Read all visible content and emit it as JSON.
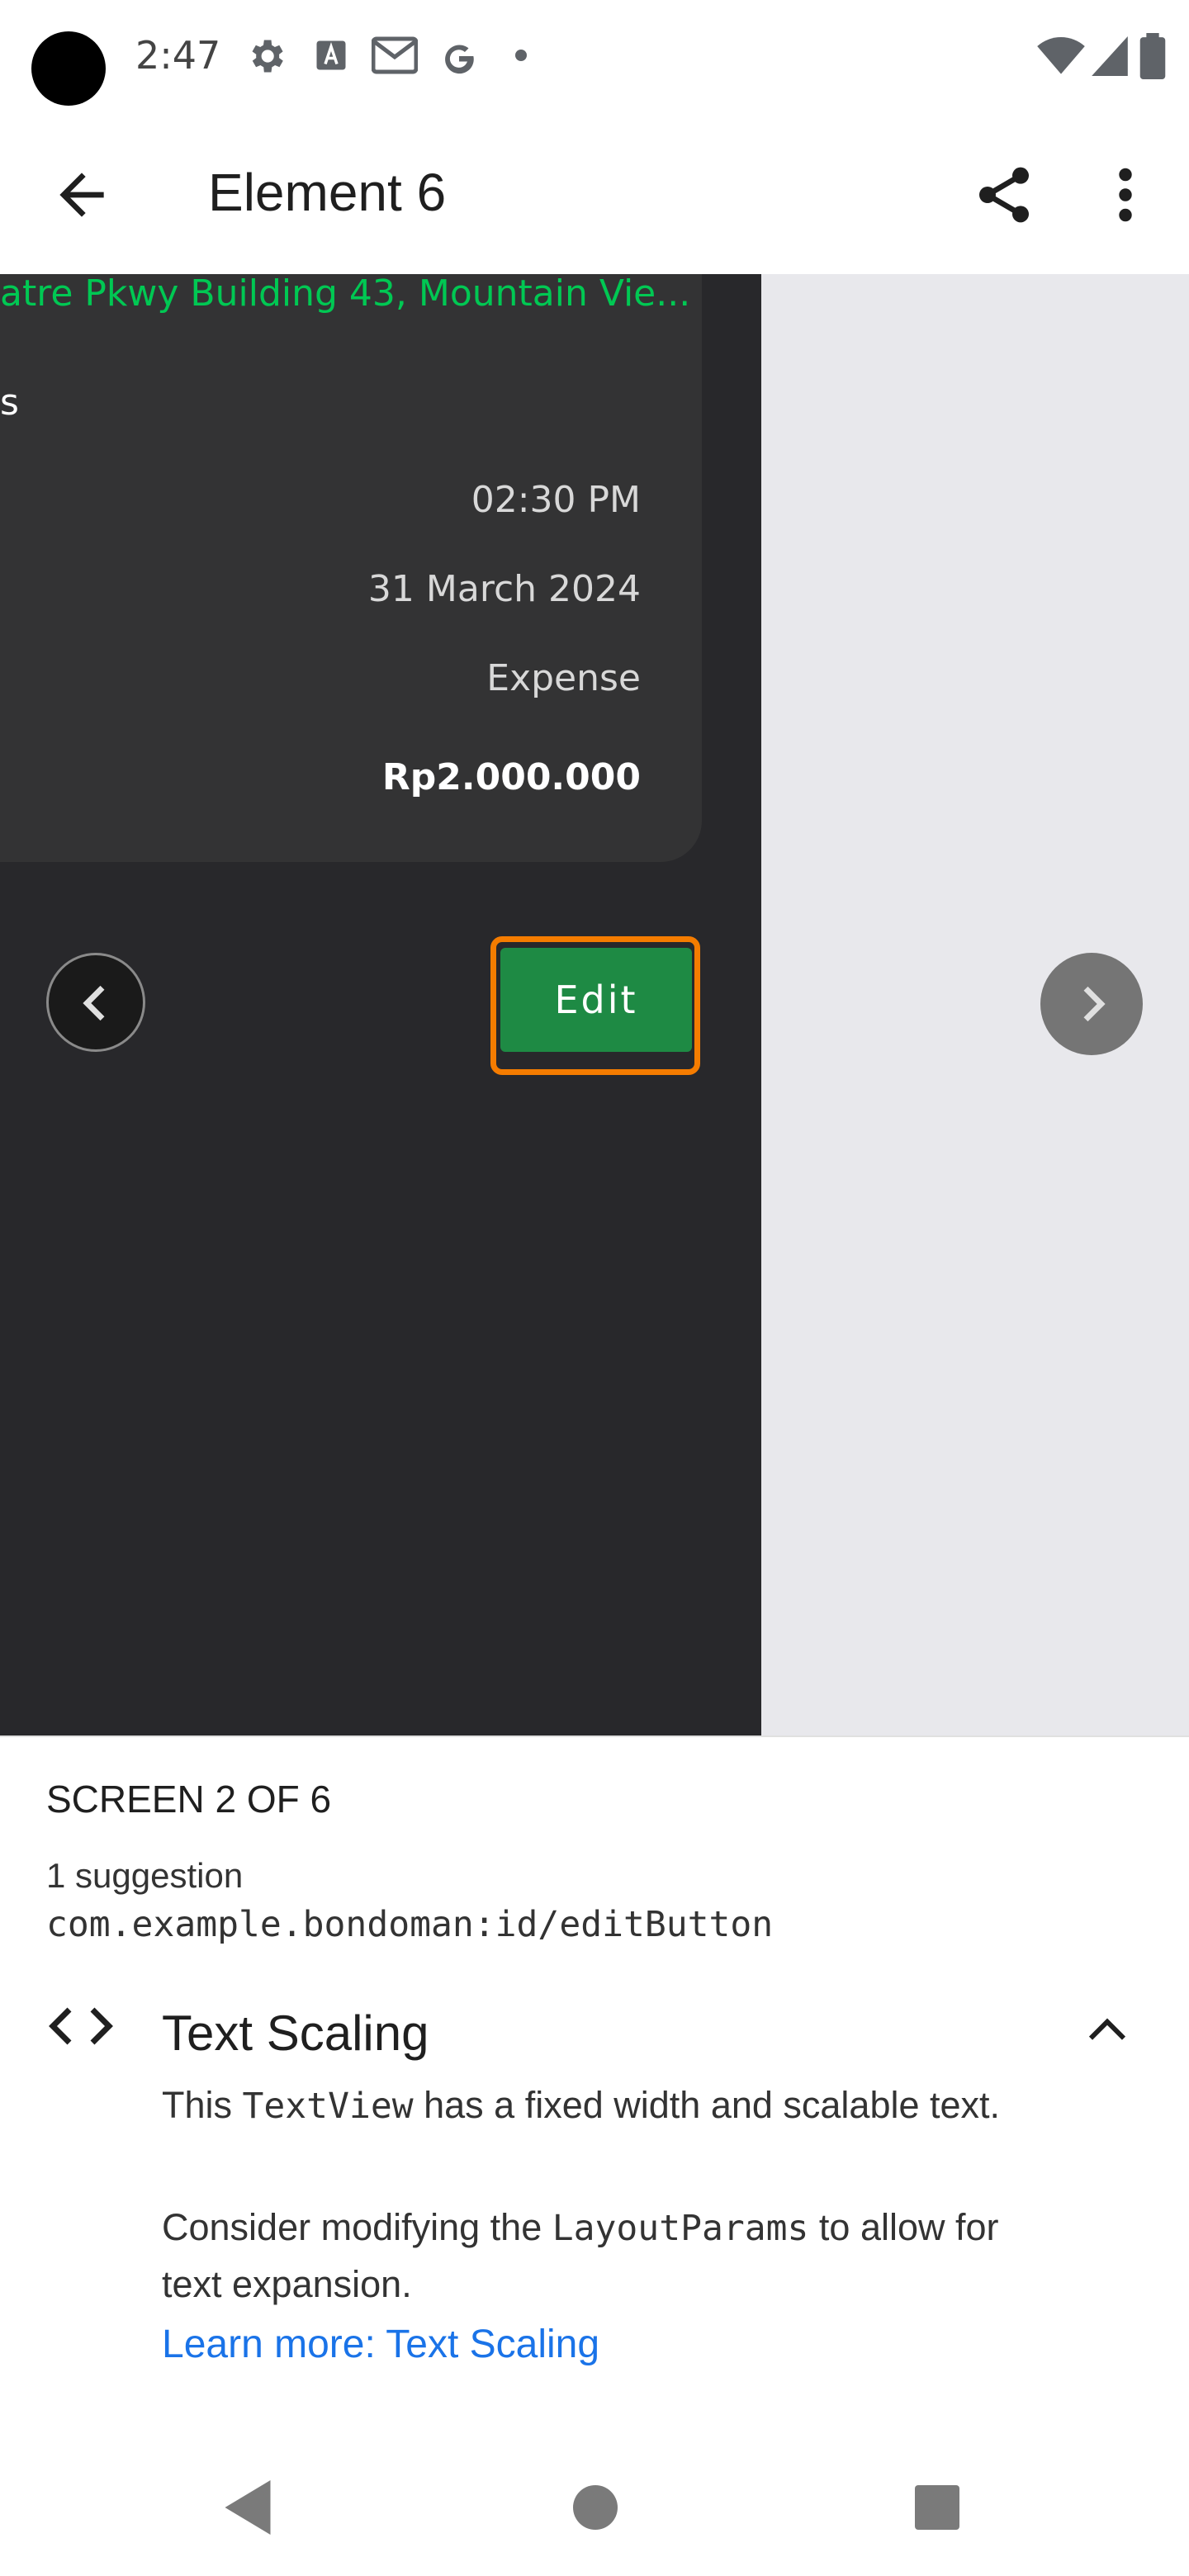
{
  "status_bar": {
    "time": "2:47"
  },
  "app_bar": {
    "title": "Element 6"
  },
  "preview": {
    "address": "atre Pkwy Building 43, Mountain Vie...",
    "partial_label": "s",
    "time": "02:30 PM",
    "date": "31 March 2024",
    "category": "Expense",
    "amount": "Rp2.000.000",
    "edit_label": "Edit"
  },
  "sheet": {
    "screen_count": "SCREEN 2 OF 6",
    "suggestion_count": "1 suggestion",
    "view_id": "com.example.bondoman:id/editButton",
    "issue": {
      "title": "Text Scaling",
      "desc1_a": "This ",
      "desc1_code": "TextView",
      "desc1_b": " has a fixed width and scalable text.",
      "desc2_a": "Consider modifying the ",
      "desc2_code": "LayoutParams",
      "desc2_b": " to allow for text expansion.",
      "link": "Learn more: Text Scaling"
    }
  },
  "colors": {
    "accent_green": "#1e8a44",
    "highlight_orange": "#f57c00",
    "link_blue": "#1a73e8",
    "address_green": "#00c853"
  }
}
